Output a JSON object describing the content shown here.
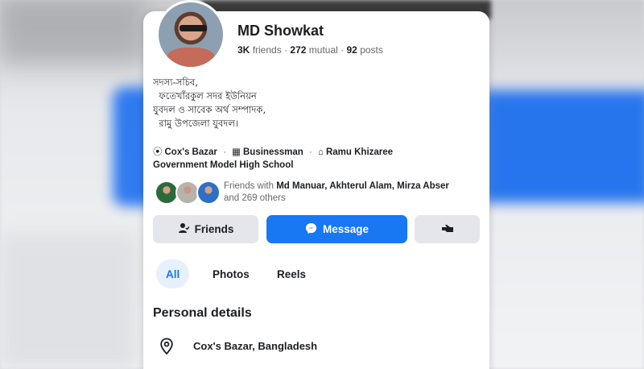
{
  "profile": {
    "name": "MD Showkat",
    "stats": {
      "friends": "3K",
      "friends_label": "friends",
      "mutual": "272",
      "mutual_label": "mutual",
      "posts": "92",
      "posts_label": "posts",
      "separator": "·"
    },
    "bio": "সদস্য-সচিব,\n  ফতেখাঁরকুল সদর ইউনিয়ন\nযুবদল ও সাবেক অর্থ সম্পাদক,\n  রামু উপজেলা যুবদল।",
    "details": {
      "location": "Cox's Bazar",
      "work": "Businessman",
      "school_line1": "Ramu Khizaree",
      "school_line2": "Government  Model High School"
    },
    "mutual_friends": {
      "prefix": "Friends with ",
      "names": "Md Manuar, Akhterul Alam, Mirza Abser",
      "suffix": " and 269 others"
    }
  },
  "actions": {
    "friends_label": "Friends",
    "message_label": "Message",
    "more_icon": "hand-pointing-icon"
  },
  "tabs": [
    {
      "label": "All",
      "active": true
    },
    {
      "label": "Photos",
      "active": false
    },
    {
      "label": "Reels",
      "active": false
    }
  ],
  "personal_details": {
    "title": "Personal details",
    "items": [
      {
        "icon": "location-pin-icon",
        "label": "Cox's Bazar, Bangladesh"
      }
    ]
  },
  "colors": {
    "accent": "#1877f2",
    "button_secondary": "#e4e6eb",
    "text_primary": "#1c1e21",
    "text_secondary": "#65676b"
  }
}
